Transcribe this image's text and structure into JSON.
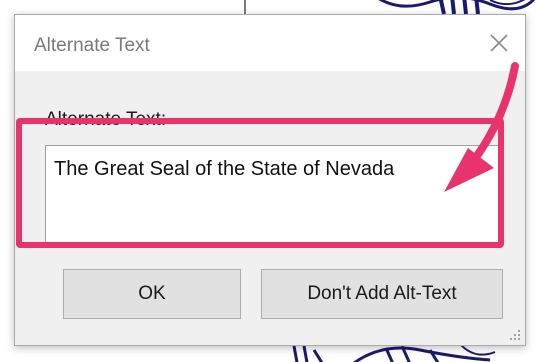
{
  "dialog": {
    "title": "Alternate Text",
    "close_icon": "close-icon",
    "field_label": "Alternate Text:",
    "field_value": "The Great Seal of the State of Nevada",
    "ok_label": "OK",
    "no_alt_label": "Don't Add Alt-Text"
  },
  "annotation": {
    "highlight_color": "#e8336d",
    "arrow_icon": "arrow-icon"
  },
  "colors": {
    "dialog_bg": "#f0f0f0",
    "titlebar_bg": "#ffffff",
    "button_bg": "#e1e1e1"
  }
}
